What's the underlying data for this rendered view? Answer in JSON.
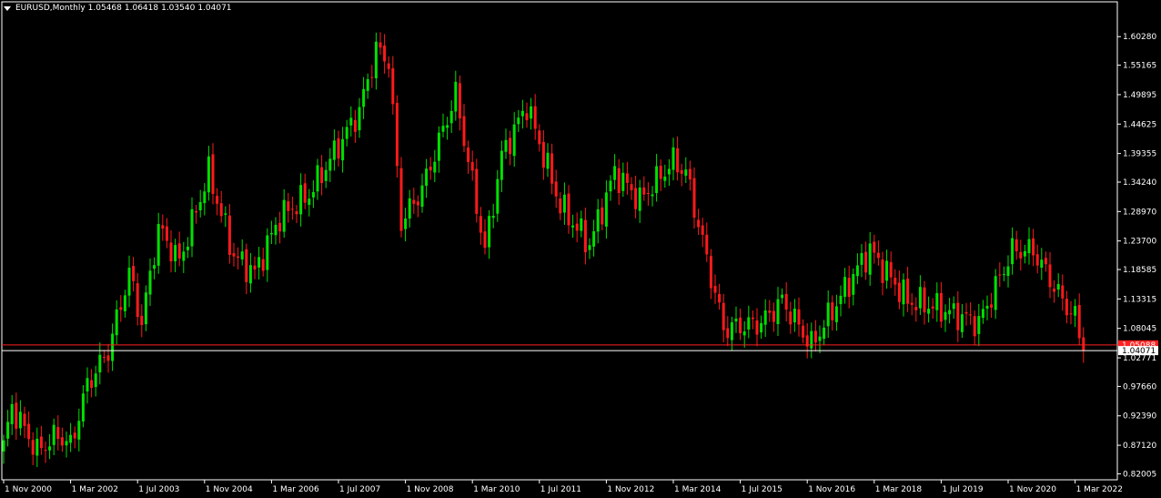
{
  "header": {
    "symbol_label": "EURUSD,Monthly",
    "ohlc": {
      "open": "1.05468",
      "high": "1.06418",
      "low": "1.03540",
      "close": "1.04071"
    }
  },
  "colors": {
    "background": "#000000",
    "bull": "#00e000",
    "bear": "#ff1a1a",
    "axis": "#ffffff",
    "bid_line": "#ffffff",
    "ask_line": "#ff2020",
    "bid_tag": "#ffffff",
    "ask_tag": "#ff2020"
  },
  "chart_data": {
    "type": "candlestick",
    "symbol": "EURUSD",
    "timeframe": "Monthly",
    "ylim": [
      0.8159,
      1.6195
    ],
    "y_ticks": [
      "1.60280",
      "1.55165",
      "1.49895",
      "1.44625",
      "1.39355",
      "1.34240",
      "1.28970",
      "1.23700",
      "1.18585",
      "1.13315",
      "1.08045",
      "1.02771",
      "0.97660",
      "0.92390",
      "0.87120",
      "0.82005"
    ],
    "x_ticks": [
      "1 Nov 2000",
      "1 Mar 2002",
      "1 Jul 2003",
      "1 Nov 2004",
      "1 Mar 2006",
      "1 Jul 2007",
      "1 Nov 2008",
      "1 Mar 2010",
      "1 Jul 2011",
      "1 Nov 2012",
      "1 Mar 2014",
      "1 Jul 2015",
      "1 Nov 2016",
      "1 Mar 2018",
      "1 Jul 2019",
      "1 Nov 2020",
      "1 Mar 2022"
    ],
    "price_levels": [
      {
        "name": "ask",
        "value": 1.0509,
        "label": "1.05088"
      },
      {
        "name": "bid",
        "value": 1.04071,
        "label": "1.04071"
      }
    ],
    "price_path": [
      {
        "date": "2000-11",
        "close": 0.87
      },
      {
        "date": "2001-01",
        "close": 0.94
      },
      {
        "date": "2001-07",
        "close": 0.86
      },
      {
        "date": "2001-12",
        "close": 0.89
      },
      {
        "date": "2002-03",
        "close": 0.87
      },
      {
        "date": "2002-07",
        "close": 0.98
      },
      {
        "date": "2002-12",
        "close": 1.04
      },
      {
        "date": "2003-05",
        "close": 1.18
      },
      {
        "date": "2003-08",
        "close": 1.09
      },
      {
        "date": "2003-12",
        "close": 1.26
      },
      {
        "date": "2004-05",
        "close": 1.2
      },
      {
        "date": "2004-12",
        "close": 1.36
      },
      {
        "date": "2005-06",
        "close": 1.21
      },
      {
        "date": "2005-11",
        "close": 1.18
      },
      {
        "date": "2006-05",
        "close": 1.28
      },
      {
        "date": "2006-12",
        "close": 1.32
      },
      {
        "date": "2007-12",
        "close": 1.47
      },
      {
        "date": "2008-04",
        "close": 1.58
      },
      {
        "date": "2008-07",
        "close": 1.56
      },
      {
        "date": "2008-10",
        "close": 1.27
      },
      {
        "date": "2009-03",
        "close": 1.33
      },
      {
        "date": "2009-11",
        "close": 1.5
      },
      {
        "date": "2010-06",
        "close": 1.22
      },
      {
        "date": "2010-10",
        "close": 1.39
      },
      {
        "date": "2011-04",
        "close": 1.48
      },
      {
        "date": "2011-12",
        "close": 1.3
      },
      {
        "date": "2012-07",
        "close": 1.23
      },
      {
        "date": "2013-01",
        "close": 1.36
      },
      {
        "date": "2013-07",
        "close": 1.31
      },
      {
        "date": "2014-03",
        "close": 1.38
      },
      {
        "date": "2014-06",
        "close": 1.36
      },
      {
        "date": "2015-03",
        "close": 1.08
      },
      {
        "date": "2015-12",
        "close": 1.09
      },
      {
        "date": "2016-05",
        "close": 1.13
      },
      {
        "date": "2016-12",
        "close": 1.05
      },
      {
        "date": "2017-12",
        "close": 1.2
      },
      {
        "date": "2018-02",
        "close": 1.22
      },
      {
        "date": "2018-11",
        "close": 1.13
      },
      {
        "date": "2019-05",
        "close": 1.12
      },
      {
        "date": "2020-04",
        "close": 1.09
      },
      {
        "date": "2020-12",
        "close": 1.22
      },
      {
        "date": "2021-05",
        "close": 1.22
      },
      {
        "date": "2021-12",
        "close": 1.13
      },
      {
        "date": "2022-03",
        "close": 1.1
      },
      {
        "date": "2022-05",
        "close": 1.04
      }
    ]
  }
}
